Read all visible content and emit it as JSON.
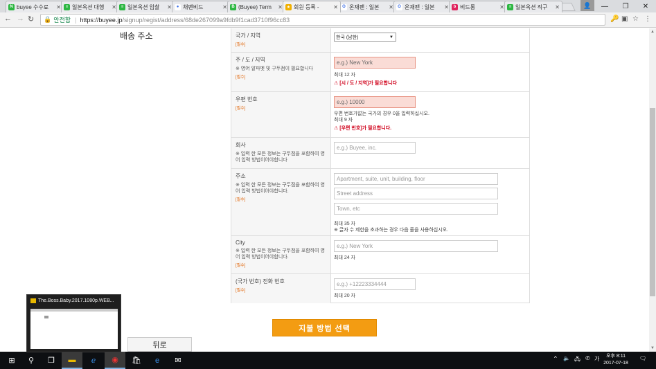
{
  "browser": {
    "tabs": [
      {
        "title": "buyee 수수료",
        "fav_color": "#2db742",
        "fav_glyph": "N"
      },
      {
        "title": "일본옥션 대행",
        "fav_color": "#2db742",
        "fav_glyph": "≡"
      },
      {
        "title": "일본옥션 입찰",
        "fav_color": "#2db742",
        "fav_glyph": "≡"
      },
      {
        "title": "채팬비드",
        "fav_color": "#ffffff",
        "fav_glyph": "●"
      },
      {
        "title": "(Buyee) Term",
        "fav_color": "#2db742",
        "fav_glyph": "B"
      },
      {
        "title": "회원 등록 -",
        "fav_color": "#f0b000",
        "fav_glyph": "★"
      },
      {
        "title": "온재팬 : 일본",
        "fav_color": "#ffffff",
        "fav_glyph": "O"
      },
      {
        "title": "온재팬 : 일본",
        "fav_color": "#ffffff",
        "fav_glyph": "O"
      },
      {
        "title": "비드롱",
        "fav_color": "#e0245e",
        "fav_glyph": "b"
      },
      {
        "title": "일본옥션 직구",
        "fav_color": "#2db742",
        "fav_glyph": "≡"
      }
    ],
    "active_tab_index": 5,
    "secure_label": "안전함",
    "url_host": "https://buyee.jp",
    "url_path": "/signup/regist/address/68de267099a9fdb9f1cad3710f96cc83"
  },
  "page": {
    "section_title": "배송 주소",
    "required_tag": "[필수]",
    "country": {
      "label": "국가 / 지역",
      "selected": "한국 (남한)"
    },
    "state": {
      "label": "주 / 도 / 지역",
      "note": "※ 영어 알파벳 및 구두점이 필요합니다",
      "placeholder": "e.g.) New York",
      "max": "최대 12 자",
      "error": "[시 / 도 / 지역]가 필요합니다"
    },
    "postal": {
      "label": "우편 번호",
      "placeholder": "e.g.) 10000",
      "hint": "우편 번호가없는 국가의 경우 0을 입력하십시오.",
      "max": "최대 9 자",
      "error": "[우편 번호]가 필요합니다."
    },
    "company": {
      "label": "회사",
      "note": "※ 입력 한 모든 정보는 구두점을 포함하여 영어 입력 방법이어야합니다",
      "placeholder": "e.g.) Buyee, inc."
    },
    "address": {
      "label": "주소",
      "note": "※ 입력 한 모든 정보는 구두점을 포함하여 영어 입력 방법이어야합니다.",
      "placeholder1": "Apartment, suite, unit, building, floor",
      "placeholder2": "Street address",
      "placeholder3": "Town, etc",
      "max": "최대 35 자",
      "overflow_note": "※ 글자 수 제한을 초과하는 경우 다음 줄을 사용하십시오."
    },
    "city": {
      "label": "City",
      "note": "※ 입력 한 모든 정보는 구두점을 포함하여 영어 입력 방법이어야합니다.",
      "placeholder": "e.g.) New York",
      "max": "최대 24 자"
    },
    "phone": {
      "label": "(국가 번호) 전화 번호",
      "placeholder": "e.g.) +12223334444",
      "max": "최대 20 자"
    },
    "pay_button": "지불 방법 선택",
    "back_button": "뒤로"
  },
  "taskbar": {
    "preview_title": "The.Boss.Baby.2017.1080p.WEB...",
    "ime": "가",
    "time": "오후 8:11",
    "date": "2017-07-18"
  }
}
